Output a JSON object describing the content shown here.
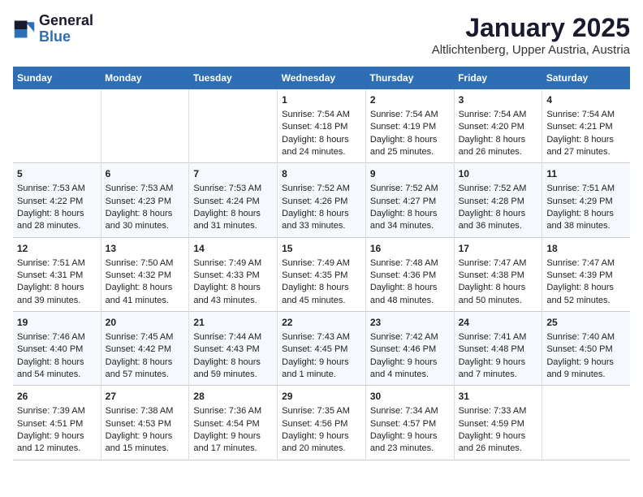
{
  "logo": {
    "line1": "General",
    "line2": "Blue"
  },
  "title": "January 2025",
  "subtitle": "Altlichtenberg, Upper Austria, Austria",
  "days_of_week": [
    "Sunday",
    "Monday",
    "Tuesday",
    "Wednesday",
    "Thursday",
    "Friday",
    "Saturday"
  ],
  "weeks": [
    [
      {
        "day": "",
        "info": ""
      },
      {
        "day": "",
        "info": ""
      },
      {
        "day": "",
        "info": ""
      },
      {
        "day": "1",
        "info": "Sunrise: 7:54 AM\nSunset: 4:18 PM\nDaylight: 8 hours\nand 24 minutes."
      },
      {
        "day": "2",
        "info": "Sunrise: 7:54 AM\nSunset: 4:19 PM\nDaylight: 8 hours\nand 25 minutes."
      },
      {
        "day": "3",
        "info": "Sunrise: 7:54 AM\nSunset: 4:20 PM\nDaylight: 8 hours\nand 26 minutes."
      },
      {
        "day": "4",
        "info": "Sunrise: 7:54 AM\nSunset: 4:21 PM\nDaylight: 8 hours\nand 27 minutes."
      }
    ],
    [
      {
        "day": "5",
        "info": "Sunrise: 7:53 AM\nSunset: 4:22 PM\nDaylight: 8 hours\nand 28 minutes."
      },
      {
        "day": "6",
        "info": "Sunrise: 7:53 AM\nSunset: 4:23 PM\nDaylight: 8 hours\nand 30 minutes."
      },
      {
        "day": "7",
        "info": "Sunrise: 7:53 AM\nSunset: 4:24 PM\nDaylight: 8 hours\nand 31 minutes."
      },
      {
        "day": "8",
        "info": "Sunrise: 7:52 AM\nSunset: 4:26 PM\nDaylight: 8 hours\nand 33 minutes."
      },
      {
        "day": "9",
        "info": "Sunrise: 7:52 AM\nSunset: 4:27 PM\nDaylight: 8 hours\nand 34 minutes."
      },
      {
        "day": "10",
        "info": "Sunrise: 7:52 AM\nSunset: 4:28 PM\nDaylight: 8 hours\nand 36 minutes."
      },
      {
        "day": "11",
        "info": "Sunrise: 7:51 AM\nSunset: 4:29 PM\nDaylight: 8 hours\nand 38 minutes."
      }
    ],
    [
      {
        "day": "12",
        "info": "Sunrise: 7:51 AM\nSunset: 4:31 PM\nDaylight: 8 hours\nand 39 minutes."
      },
      {
        "day": "13",
        "info": "Sunrise: 7:50 AM\nSunset: 4:32 PM\nDaylight: 8 hours\nand 41 minutes."
      },
      {
        "day": "14",
        "info": "Sunrise: 7:49 AM\nSunset: 4:33 PM\nDaylight: 8 hours\nand 43 minutes."
      },
      {
        "day": "15",
        "info": "Sunrise: 7:49 AM\nSunset: 4:35 PM\nDaylight: 8 hours\nand 45 minutes."
      },
      {
        "day": "16",
        "info": "Sunrise: 7:48 AM\nSunset: 4:36 PM\nDaylight: 8 hours\nand 48 minutes."
      },
      {
        "day": "17",
        "info": "Sunrise: 7:47 AM\nSunset: 4:38 PM\nDaylight: 8 hours\nand 50 minutes."
      },
      {
        "day": "18",
        "info": "Sunrise: 7:47 AM\nSunset: 4:39 PM\nDaylight: 8 hours\nand 52 minutes."
      }
    ],
    [
      {
        "day": "19",
        "info": "Sunrise: 7:46 AM\nSunset: 4:40 PM\nDaylight: 8 hours\nand 54 minutes."
      },
      {
        "day": "20",
        "info": "Sunrise: 7:45 AM\nSunset: 4:42 PM\nDaylight: 8 hours\nand 57 minutes."
      },
      {
        "day": "21",
        "info": "Sunrise: 7:44 AM\nSunset: 4:43 PM\nDaylight: 8 hours\nand 59 minutes."
      },
      {
        "day": "22",
        "info": "Sunrise: 7:43 AM\nSunset: 4:45 PM\nDaylight: 9 hours\nand 1 minute."
      },
      {
        "day": "23",
        "info": "Sunrise: 7:42 AM\nSunset: 4:46 PM\nDaylight: 9 hours\nand 4 minutes."
      },
      {
        "day": "24",
        "info": "Sunrise: 7:41 AM\nSunset: 4:48 PM\nDaylight: 9 hours\nand 7 minutes."
      },
      {
        "day": "25",
        "info": "Sunrise: 7:40 AM\nSunset: 4:50 PM\nDaylight: 9 hours\nand 9 minutes."
      }
    ],
    [
      {
        "day": "26",
        "info": "Sunrise: 7:39 AM\nSunset: 4:51 PM\nDaylight: 9 hours\nand 12 minutes."
      },
      {
        "day": "27",
        "info": "Sunrise: 7:38 AM\nSunset: 4:53 PM\nDaylight: 9 hours\nand 15 minutes."
      },
      {
        "day": "28",
        "info": "Sunrise: 7:36 AM\nSunset: 4:54 PM\nDaylight: 9 hours\nand 17 minutes."
      },
      {
        "day": "29",
        "info": "Sunrise: 7:35 AM\nSunset: 4:56 PM\nDaylight: 9 hours\nand 20 minutes."
      },
      {
        "day": "30",
        "info": "Sunrise: 7:34 AM\nSunset: 4:57 PM\nDaylight: 9 hours\nand 23 minutes."
      },
      {
        "day": "31",
        "info": "Sunrise: 7:33 AM\nSunset: 4:59 PM\nDaylight: 9 hours\nand 26 minutes."
      },
      {
        "day": "",
        "info": ""
      }
    ]
  ]
}
